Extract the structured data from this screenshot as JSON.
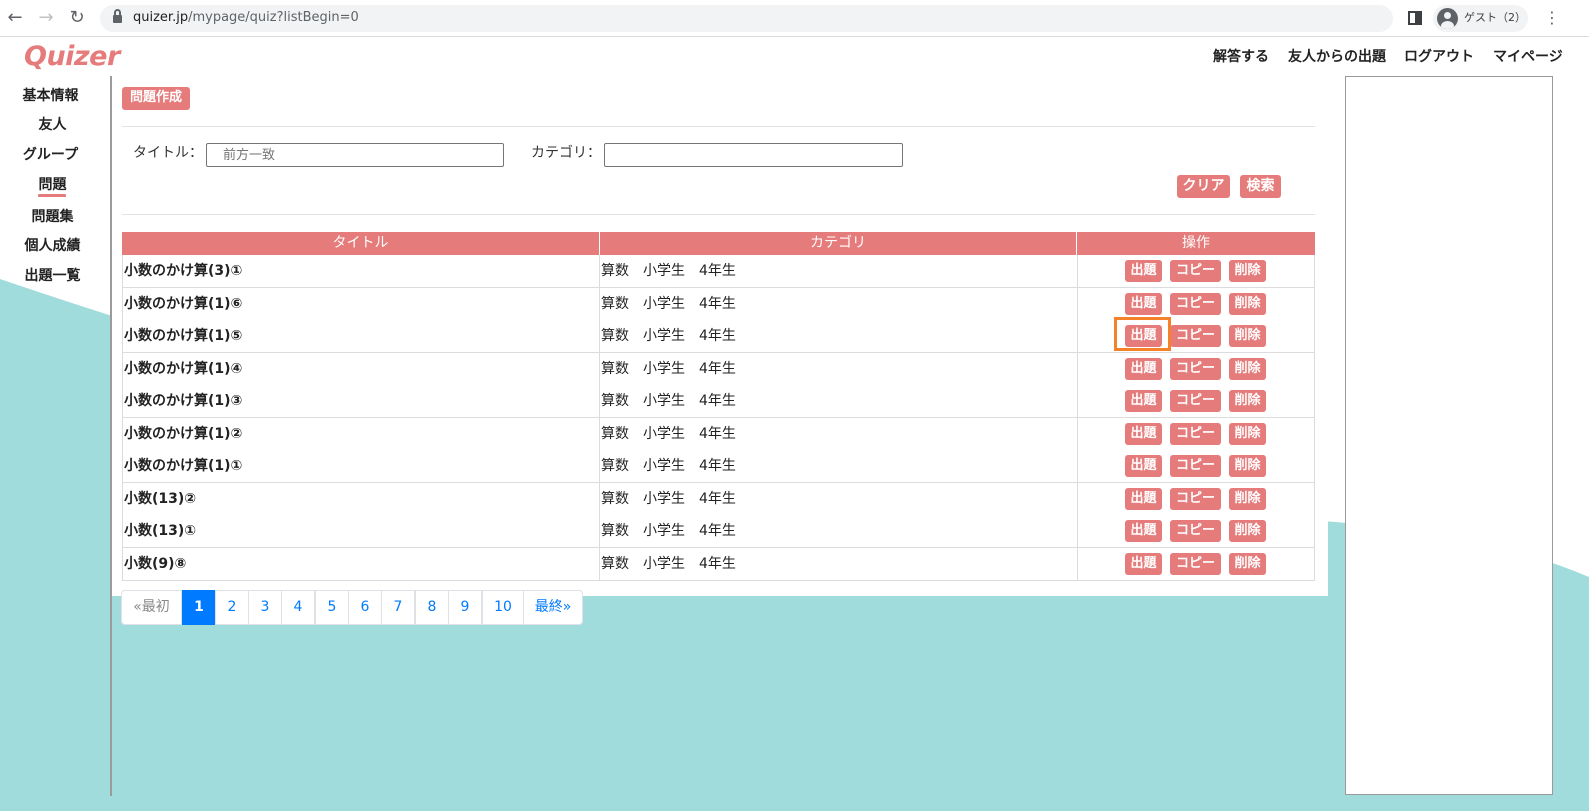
{
  "browser": {
    "url_host": "quizer.jp",
    "url_path": "/mypage/quiz?listBegin=0",
    "profile_label": "ゲスト（2）"
  },
  "header": {
    "logo": "Quizer",
    "nav": [
      "解答する",
      "友人からの出題",
      "ログアウト",
      "マイページ"
    ]
  },
  "sidebar": {
    "items": [
      "基本情報",
      "友人",
      "グループ",
      "問題",
      "問題集",
      "個人成績",
      "出題一覧"
    ],
    "active": "問題"
  },
  "toolbar": {
    "create_label": "問題作成"
  },
  "search": {
    "title_label": "タイトル：",
    "title_placeholder": "前方一致",
    "category_label": "カテゴリ：",
    "category_value": "",
    "clear_label": "クリア",
    "search_label": "検索"
  },
  "table": {
    "headers": [
      "タイトル",
      "カテゴリ",
      "操作"
    ],
    "rows": [
      {
        "title": "小数のかけ算(3)①",
        "category": "算数　小学生　4年生"
      },
      {
        "title": "小数のかけ算(1)⑥",
        "category": "算数　小学生　4年生"
      },
      {
        "title": "小数のかけ算(1)⑤",
        "category": "算数　小学生　4年生"
      },
      {
        "title": "小数のかけ算(1)④",
        "category": "算数　小学生　4年生"
      },
      {
        "title": "小数のかけ算(1)③",
        "category": "算数　小学生　4年生"
      },
      {
        "title": "小数のかけ算(1)②",
        "category": "算数　小学生　4年生"
      },
      {
        "title": "小数のかけ算(1)①",
        "category": "算数　小学生　4年生"
      },
      {
        "title": "小数(13)②",
        "category": "算数　小学生　4年生"
      },
      {
        "title": "小数(13)①",
        "category": "算数　小学生　4年生"
      },
      {
        "title": "小数(9)⑧",
        "category": "算数　小学生　4年生"
      }
    ],
    "actions": {
      "assign": "出題",
      "copy": "コピー",
      "delete": "削除"
    },
    "highlighted_row": 2
  },
  "pagination": {
    "first": "«最初",
    "pages": [
      "1",
      "2",
      "3",
      "4",
      "5",
      "6",
      "7",
      "8",
      "9",
      "10"
    ],
    "last": "最終»",
    "current": "1"
  },
  "colors": {
    "brand": "#e57b7b",
    "teal_background": "#a1dcdc",
    "highlight": "#f5822a",
    "page_active": "#007bff"
  }
}
